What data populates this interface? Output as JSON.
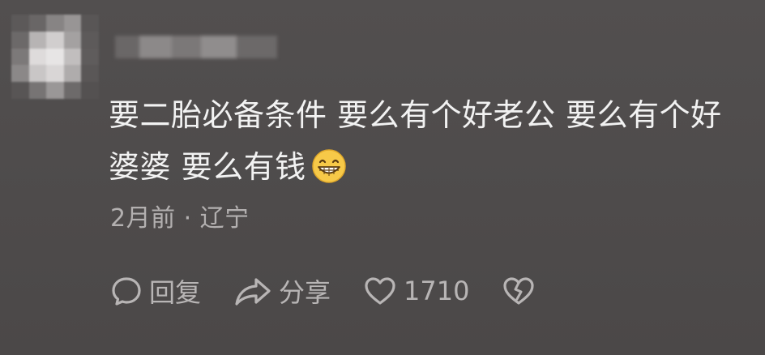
{
  "comment": {
    "line1": "要二胎必备条件 要么有个好老公 要么有个好",
    "line2": "婆婆 要么有钱",
    "emoji": "grinning-face-emoji"
  },
  "meta": {
    "time": "2月前",
    "separator": "·",
    "location": "辽宁"
  },
  "actions": {
    "reply_label": "回复",
    "share_label": "分享",
    "like_count": "1710"
  },
  "icons": {
    "reply": "comment-bubble-icon",
    "share": "share-arrow-icon",
    "like": "heart-outline-icon",
    "dislike": "broken-heart-icon"
  },
  "colors": {
    "background": "#4e4b4b",
    "comment_text": "#f2f2f2",
    "meta_text": "#b3b0b0"
  }
}
